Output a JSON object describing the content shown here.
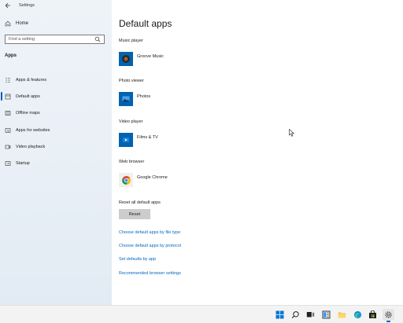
{
  "window": {
    "title": "Settings"
  },
  "sidebar": {
    "home_label": "Home",
    "search": {
      "placeholder": "Find a setting"
    },
    "section_label": "Apps",
    "items": [
      {
        "label": "Apps & features",
        "icon": "apps-features-icon"
      },
      {
        "label": "Default apps",
        "icon": "default-apps-icon",
        "active": true
      },
      {
        "label": "Offline maps",
        "icon": "offline-maps-icon"
      },
      {
        "label": "Apps for websites",
        "icon": "apps-websites-icon"
      },
      {
        "label": "Video playback",
        "icon": "video-playback-icon"
      },
      {
        "label": "Startup",
        "icon": "startup-icon"
      }
    ]
  },
  "main": {
    "title": "Default apps",
    "groups": [
      {
        "label": "Music player",
        "app": "Groove Music"
      },
      {
        "label": "Photo viewer",
        "app": "Photos"
      },
      {
        "label": "Video player",
        "app": "Films & TV"
      },
      {
        "label": "Web browser",
        "app": "Google Chrome"
      }
    ],
    "reset": {
      "label": "Reset all default apps",
      "button": "Reset"
    },
    "links": [
      "Choose default apps by file type",
      "Choose default apps by protocol",
      "Set defaults by app",
      "Recommended browser settings"
    ]
  },
  "colors": {
    "accent": "#0067c0",
    "tile_blue": "#0063b1"
  }
}
